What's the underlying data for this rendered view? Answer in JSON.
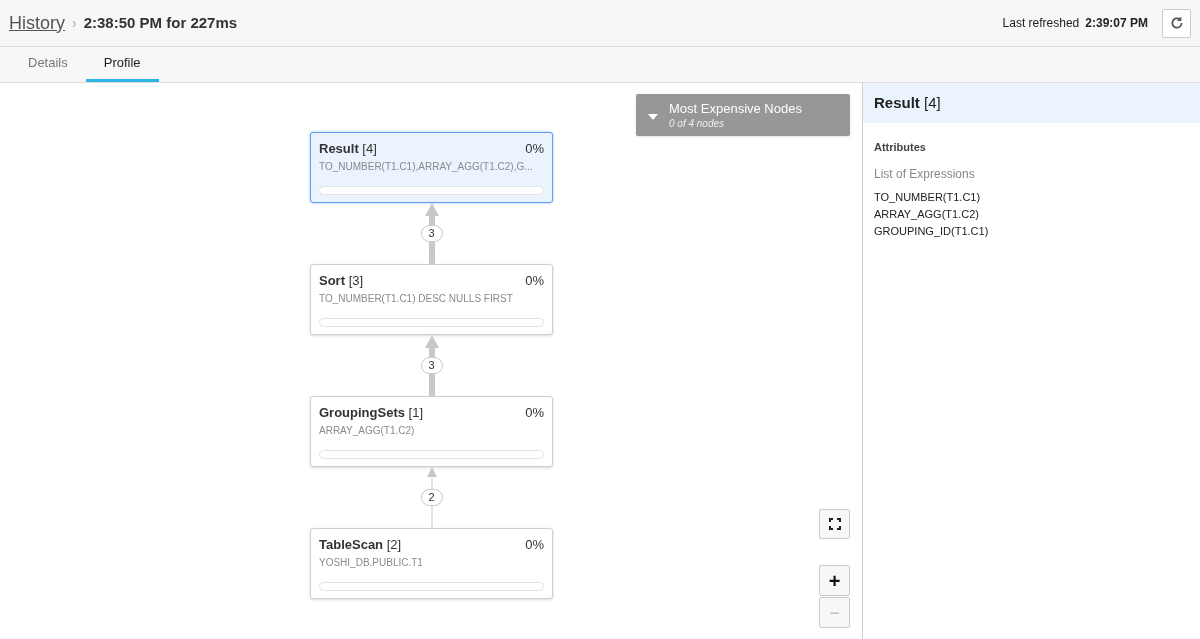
{
  "header": {
    "breadcrumb_link": "History",
    "breadcrumb_separator": "›",
    "title": "2:38:50 PM for 227ms",
    "refreshed_label": "Last refreshed",
    "refreshed_time": "2:39:07 PM"
  },
  "tabs": [
    {
      "label": "Details",
      "selected": false
    },
    {
      "label": "Profile",
      "selected": true
    }
  ],
  "expensive_nodes": {
    "title": "Most Expensive Nodes",
    "subtitle": "0 of 4 nodes",
    "expanded": false
  },
  "nodes": [
    {
      "name": "Result",
      "id": "[4]",
      "percent": "0%",
      "detail": "TO_NUMBER(T1.C1),ARRAY_AGG(T1.C2),G...",
      "level": 0,
      "selected": true
    },
    {
      "name": "Sort",
      "id": "[3]",
      "percent": "0%",
      "detail": "TO_NUMBER(T1.C1) DESC NULLS FIRST",
      "level": 0,
      "selected": false
    },
    {
      "name": "GroupingSets",
      "id": "[1]",
      "percent": "0%",
      "detail": "ARRAY_AGG(T1.C2)",
      "level": 0,
      "selected": false
    },
    {
      "name": "TableScan",
      "id": "[2]",
      "percent": "0%",
      "detail": "YOSHI_DB.PUBLIC.T1",
      "level": 0,
      "selected": false
    }
  ],
  "edges": [
    {
      "label": "3",
      "kind": "thick"
    },
    {
      "label": "3",
      "kind": "thick"
    },
    {
      "label": "2",
      "kind": "thin"
    }
  ],
  "zoom_controls": {
    "zoom_in": "+",
    "zoom_out": "−",
    "zoom_out_disabled": true
  },
  "detail_panel": {
    "name": "Result",
    "id": "[4]",
    "section": "Attributes",
    "list_label": "List of Expressions",
    "expressions": [
      "TO_NUMBER(T1.C1)",
      "ARRAY_AGG(T1.C2)",
      "GROUPING_ID(T1.C1)"
    ]
  }
}
